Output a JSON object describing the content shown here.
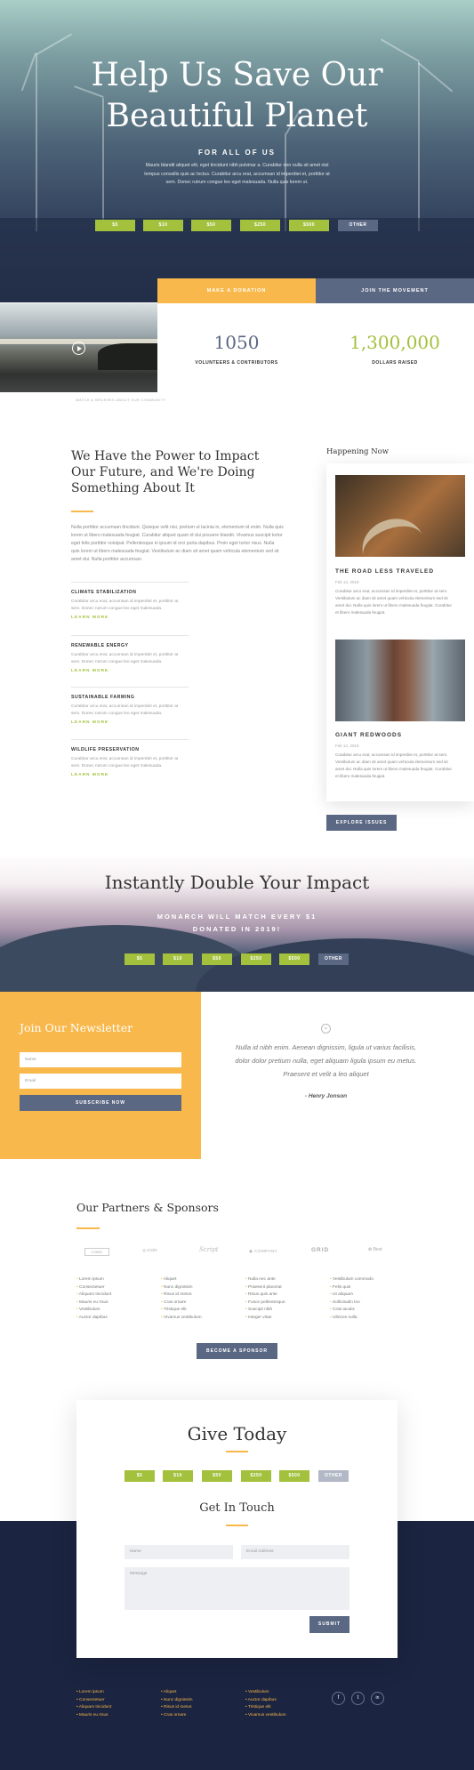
{
  "hero": {
    "title_line1": "Help Us Save Our",
    "title_line2": "Beautiful Planet",
    "subtitle": "FOR ALL OF US",
    "text1": "Mauris blandit aliquet elit, eget tincidunt nibh pulvinar a. Curabitur non nulla sit amet nisl",
    "text2": "tempus convallis quis ac lectus. Curabitur arcu erat, accumsan id imperdiet et, porttitor at",
    "text3": "sem. Donec rutrum congue leo eget malesuada. Nulla quis lorem ut."
  },
  "amounts": [
    "$5",
    "$10",
    "$50",
    "$250",
    "$500",
    "OTHER"
  ],
  "tabs": {
    "donation": "MAKE A DONATION",
    "movement": "JOIN THE MOVEMENT"
  },
  "video_caption": "WATCH & BRUSHES ABOUT OUR COMMUNITY",
  "stats": [
    {
      "value": "1050",
      "label": "VOLUNTEERS & CONTRIBUTORS",
      "color": "#5b6883"
    },
    {
      "value": "1,300,000",
      "label": "DOLLARS RAISED",
      "color": "#a3c13d"
    }
  ],
  "impact": {
    "line1": "We Have the Power to Impact",
    "line2": "Our Future, and We're Doing",
    "line3": "Something About It",
    "para1": "Nulla porttitor accumsan tincidunt. Quisque velit nisi, pretium ut lacinia in, elementum id enim. Nulla quis",
    "para2": "lorem ut libero malesuada feugiat. Curabitur aliquet quam id dui posuere blandit. Vivamus suscipit tortor",
    "para3": "eget felis porttitor volutpat. Pellentesque in ipsum id orci porta dapibus. Proin eget tortor risus. Nulla",
    "para4": "quis lorem ut libero malesuada feugiat. Vestibulum ac diam sit amet quam vehicula elementum sed sit",
    "para5": "amet dui. Nulla porttitor accumsan."
  },
  "cause_cards": [
    {
      "title": "CLIMATE STABILIZATION",
      "l1": "Curabitur arcu erat, accumsan id imperdiet et, porttitor at",
      "l2": "sem. Donec rutrum congue leo eget malesuada.",
      "link": "LEARN MORE"
    },
    {
      "title": "RENEWABLE ENERGY",
      "l1": "Curabitur arcu erat, accumsan id imperdiet et, porttitor at",
      "l2": "sem. Donec rutrum congue leo eget malesuada.",
      "link": "LEARN MORE"
    },
    {
      "title": "SUSTAINABLE FARMING",
      "l1": "Curabitur arcu erat, accumsan id imperdiet et, porttitor at",
      "l2": "sem. Donec rutrum congue leo eget malesuada.",
      "link": "LEARN MORE"
    },
    {
      "title": "WILDLIFE PRESERVATION",
      "l1": "Curabitur arcu erat, accumsan id imperdiet et, porttitor at",
      "l2": "sem. Donec rutrum congue leo eget malesuada.",
      "link": "LEARN MORE"
    }
  ],
  "happening": {
    "title": "Happening Now",
    "posts": [
      {
        "title": "THE ROAD LESS TRAVELED",
        "date": "Feb 12, 2019",
        "l1": "Curabitur arcu erat, accumsan id imperdiet et, porttitor at sem.",
        "l2": "Vestibulum ac diam sit amet quam vehicula elementum sed sit",
        "l3": "amet dui. Nulla quis lorem ut libero malesuada feugiat. Curabitur",
        "l4": "et libero malesuada feugiat."
      },
      {
        "title": "GIANT REDWOODS",
        "date": "Feb 12, 2019",
        "l1": "Curabitur arcu erat, accumsan id imperdiet et, porttitor at sem.",
        "l2": "Vestibulum ac diam sit amet quam vehicula elementum sed sit",
        "l3": "amet dui. Nulla quis lorem ut libero malesuada feugiat. Curabitur",
        "l4": "et libero malesuada feugiat."
      }
    ],
    "button": "EXPLORE ISSUES"
  },
  "double": {
    "title": "Instantly Double Your Impact",
    "line1": "MONARCH WILL MATCH EVERY $1",
    "line2": "DONATED IN 2019!"
  },
  "newsletter": {
    "title": "Join Our Newsletter",
    "name_placeholder": "Name",
    "email_placeholder": "Email",
    "button": "SUBSCRIBE NOW"
  },
  "quote": {
    "mark": "“",
    "l1": "Nulla id nibh enim. Aenean dignissim, ligula ut varius facilisis,",
    "l2": "dolor dolor pretium nulla, eget aliquam ligula ipsum eu metus.",
    "l3": "Praesent et velit a leo aliquet",
    "author": "- Henry Jonson"
  },
  "partners": {
    "title": "Our Partners & Sponsors",
    "logos": [
      "LOGO",
      "ICON",
      "Script",
      "COMPANY",
      "GRID",
      "Best"
    ],
    "col1": [
      "Lorem ipsum",
      "Consectetuer",
      "Aliquam tincidunt",
      "Mauris eu risus",
      "Vestibulum",
      "Auctor dapibus"
    ],
    "col2": [
      "Aliquet",
      "Nunc dignissim",
      "Risus id metus",
      "Cras ornare",
      "Tristique elit",
      "Vivamus vestibulum"
    ],
    "col3": [
      "Nulla nec ante",
      "Praesent placerat",
      "Risus quis ante",
      "Fusce pellentesque",
      "Suscipit nibh",
      "Integer vitae"
    ],
    "col4": [
      "Vestibulum commodo",
      "Felis quis",
      "Ut aliquam",
      "Sollicitudin leo",
      "Cras iaculis",
      "Ultrices nulla"
    ],
    "button": "BECOME A SPONSOR"
  },
  "give": {
    "title": "Give Today"
  },
  "contact": {
    "title": "Get In Touch",
    "name_placeholder": "Name",
    "email_placeholder": "Email Address",
    "message_placeholder": "Message",
    "button": "SUBMIT"
  },
  "footer": {
    "col1": [
      "Lorem ipsum",
      "Consectetuer",
      "Aliquam tincidunt",
      "Mauris eu risus"
    ],
    "col2": [
      "Aliquet",
      "Nunc dignissim",
      "Risus id metus",
      "Cras ornare"
    ],
    "col3": [
      "Vestibulum",
      "Auctor dapibus",
      "Tristique elit",
      "Vivamus vestibulum"
    ],
    "social": [
      "f",
      "t",
      "in"
    ]
  },
  "colors": {
    "accent_green": "#a3c13d",
    "accent_orange": "#f8b84c",
    "slate": "#5b6883",
    "navy": "#1b2440"
  }
}
